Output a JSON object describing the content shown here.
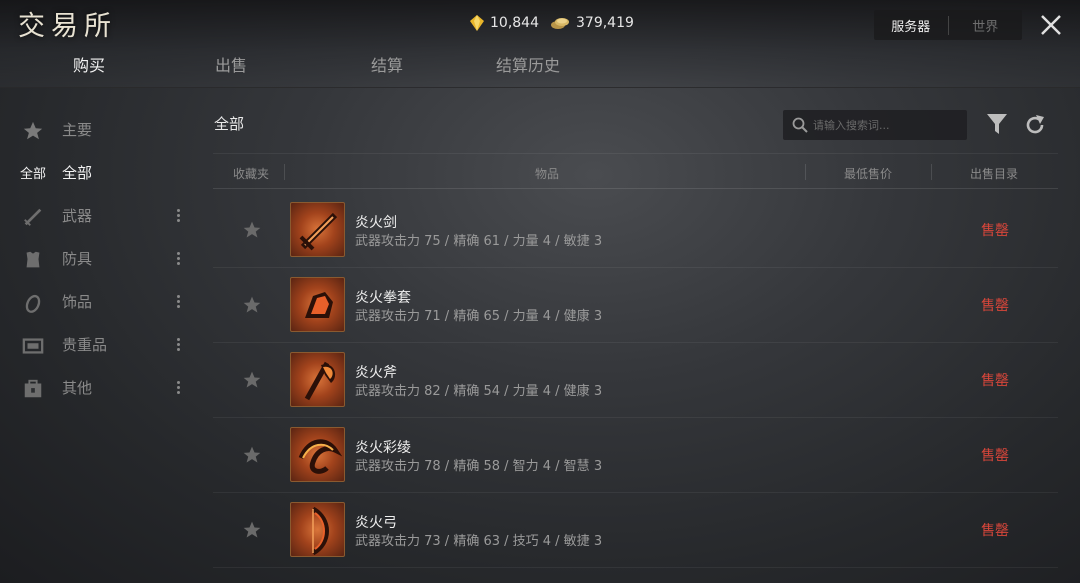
{
  "header": {
    "logo": "交易所",
    "gold": "10,844",
    "silver": "379,419",
    "server_options": [
      "服务器",
      "世界"
    ]
  },
  "tabs": [
    "购买",
    "出售",
    "结算",
    "结算历史"
  ],
  "sidebar": {
    "items": [
      {
        "label": "主要",
        "icon": "star-icon"
      },
      {
        "prefix": "全部",
        "label": "全部"
      },
      {
        "label": "武器",
        "icon": "sword-icon"
      },
      {
        "label": "防具",
        "icon": "armor-icon"
      },
      {
        "label": "饰品",
        "icon": "ring-icon"
      },
      {
        "label": "贵重品",
        "icon": "chest-icon"
      },
      {
        "label": "其他",
        "icon": "bag-icon"
      }
    ]
  },
  "main": {
    "title": "全部",
    "search_placeholder": "请输入搜索词..."
  },
  "table": {
    "headers": [
      "收藏夹",
      "物品",
      "最低售价",
      "出售目录"
    ],
    "rows": [
      {
        "name": "炎火剑",
        "stats": "武器攻击力 75  / 精确 61  / 力量 4  / 敏捷 3",
        "price": "",
        "status": "售罄"
      },
      {
        "name": "炎火拳套",
        "stats": "武器攻击力 71  / 精确 65  / 力量 4  / 健康 3",
        "price": "",
        "status": "售罄"
      },
      {
        "name": "炎火斧",
        "stats": "武器攻击力 82  / 精确 54  / 力量 4  / 健康 3",
        "price": "",
        "status": "售罄"
      },
      {
        "name": "炎火彩绫",
        "stats": "武器攻击力 78  / 精确 58  / 智力 4  / 智慧 3",
        "price": "",
        "status": "售罄"
      },
      {
        "name": "炎火弓",
        "stats": "武器攻击力 73  / 精确 63  / 技巧 4  / 敏捷 3",
        "price": "",
        "status": "售罄"
      }
    ]
  },
  "colors": {
    "sold_out": "#d9463a",
    "accent_gold": "#e8b52a"
  }
}
